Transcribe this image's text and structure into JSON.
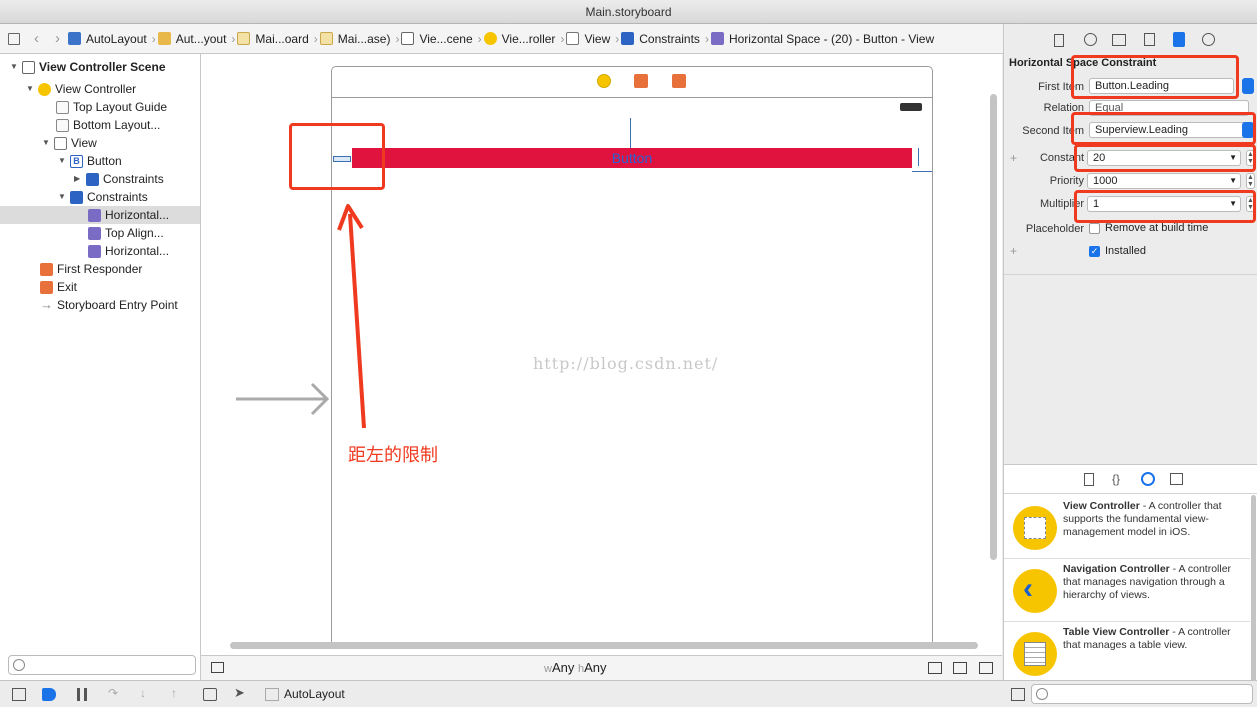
{
  "window": {
    "title": "Main.storyboard"
  },
  "jumpbar": {
    "crumbs": [
      {
        "label": "AutoLayout",
        "icon": "project-icon"
      },
      {
        "label": "Aut...yout",
        "icon": "folder-icon"
      },
      {
        "label": "Mai...oard",
        "icon": "storyboard-file-icon"
      },
      {
        "label": "Mai...ase)",
        "icon": "storyboard-file-icon"
      },
      {
        "label": "Vie...cene",
        "icon": "scene-icon"
      },
      {
        "label": "Vie...roller",
        "icon": "view-controller-icon"
      },
      {
        "label": "View",
        "icon": "view-icon"
      },
      {
        "label": "Constraints",
        "icon": "constraints-icon"
      },
      {
        "label": "Horizontal Space - (20) - Button - View",
        "icon": "constraint-icon"
      }
    ]
  },
  "outline": {
    "items": [
      {
        "label": "View Controller Scene",
        "bold": true
      },
      {
        "label": "View Controller"
      },
      {
        "label": "Top Layout Guide"
      },
      {
        "label": "Bottom Layout..."
      },
      {
        "label": "View"
      },
      {
        "label": "Button",
        "badge": "B"
      },
      {
        "label": "Constraints"
      },
      {
        "label": "Constraints"
      },
      {
        "label": "Horizontal..."
      },
      {
        "label": "Top Align..."
      },
      {
        "label": "Horizontal..."
      },
      {
        "label": "First Responder"
      },
      {
        "label": "Exit"
      },
      {
        "label": "Storyboard Entry Point"
      }
    ]
  },
  "canvas": {
    "button_label": "Button",
    "watermark": "http://blog.csdn.net/",
    "annotation": "距左的限制",
    "size_class_w": "w",
    "size_class_w_value": "Any",
    "size_class_h": "h",
    "size_class_h_value": "Any"
  },
  "inspector": {
    "section_title": "Horizontal Space Constraint",
    "first_item_label": "First Item",
    "first_item_value": "Button.Leading",
    "relation_label": "Relation",
    "relation_value": "Equal",
    "second_item_label": "Second Item",
    "second_item_value": "Superview.Leading",
    "constant_label": "Constant",
    "constant_value": "20",
    "priority_label": "Priority",
    "priority_value": "1000",
    "multiplier_label": "Multiplier",
    "multiplier_value": "1",
    "placeholder_label": "Placeholder",
    "placeholder_option": "Remove at build time",
    "installed_label": "Installed",
    "installed_checked": true,
    "placeholder_checked": false
  },
  "library": {
    "items": [
      {
        "title": "View Controller",
        "desc": " - A controller that supports the fundamental view-management model in iOS."
      },
      {
        "title": "Navigation Controller",
        "desc": " - A controller that manages navigation through a hierarchy of views."
      },
      {
        "title": "Table View Controller",
        "desc": " - A controller that manages a table view."
      }
    ]
  },
  "debugbar": {
    "target": "AutoLayout"
  },
  "colors": {
    "button_fill": "#e0123e",
    "button_text": "#2a63d6",
    "annotation": "#f03a20",
    "accent": "#1a73e8",
    "vc_yellow": "#f7c500"
  }
}
